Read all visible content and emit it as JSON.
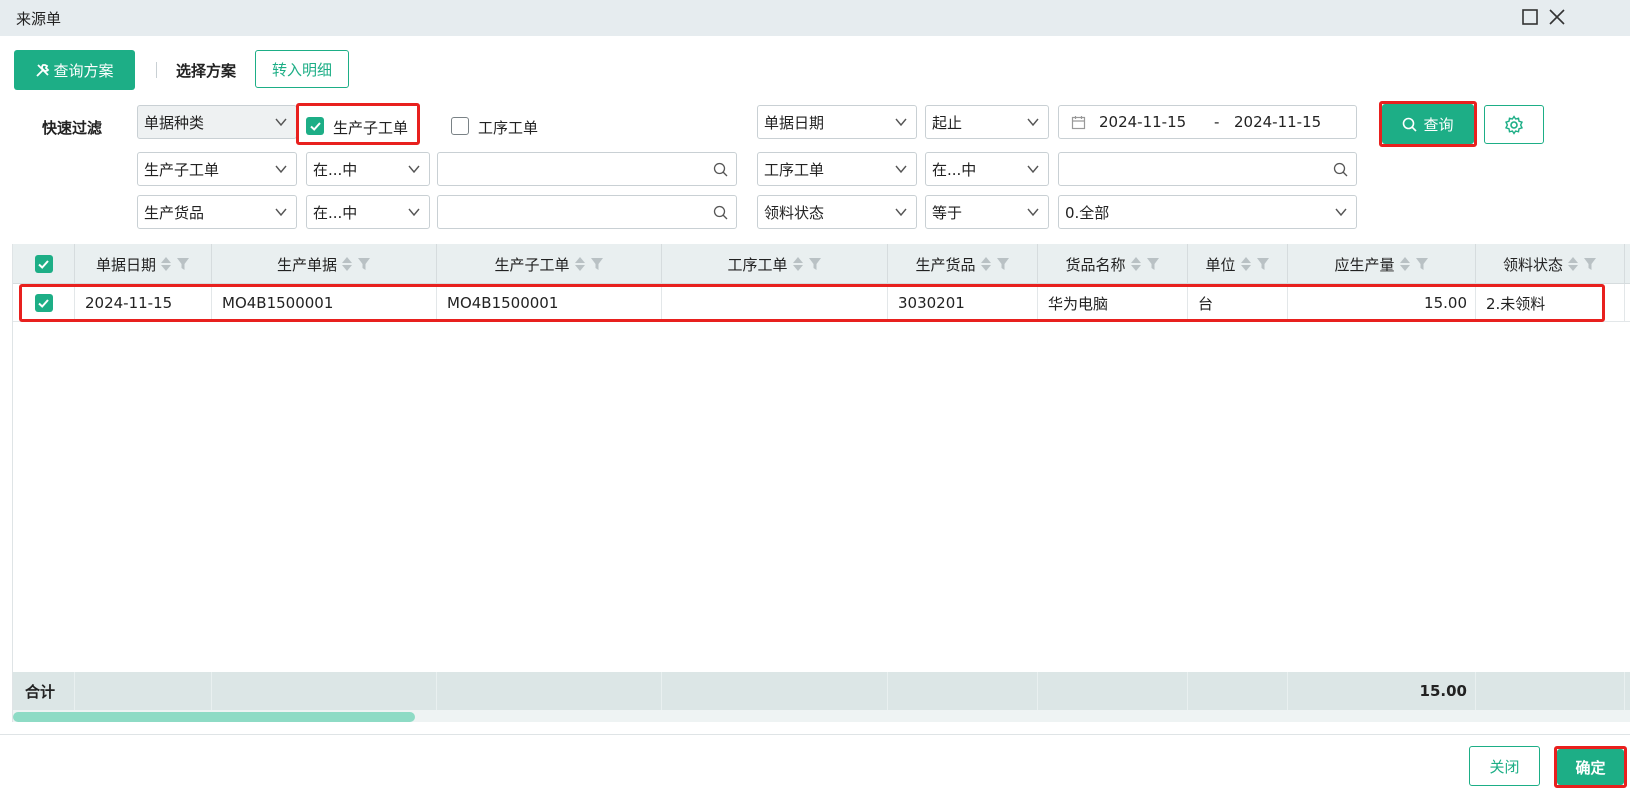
{
  "window": {
    "title": "来源单"
  },
  "toolbar": {
    "query_scheme_label": "查询方案",
    "select_scheme_label": "选择方案",
    "transfer_detail_label": "转入明细"
  },
  "filter": {
    "quick_filter_label": "快速过滤",
    "doc_type_select": "单据种类",
    "checkbox_production_sub": {
      "label": "生产子工单",
      "checked": true
    },
    "checkbox_process_order": {
      "label": "工序工单",
      "checked": false
    },
    "date_field_select": "单据日期",
    "date_mode_select": "起止",
    "date_start": "2024-11-15",
    "date_sep": "-",
    "date_end": "2024-11-15",
    "query_button_label": "查询",
    "row2": {
      "field1": "生产子工单",
      "op1": "在...中",
      "value1": "",
      "field2": "工序工单",
      "op2": "在...中",
      "value2": ""
    },
    "row3": {
      "field1": "生产货品",
      "op1": "在...中",
      "value1": "",
      "field2": "领料状态",
      "op2": "等于",
      "value2": "0.全部"
    }
  },
  "grid": {
    "columns": [
      "单据日期",
      "生产单据",
      "生产子工单",
      "工序工单",
      "生产货品",
      "货品名称",
      "单位",
      "应生产量",
      "领料状态"
    ],
    "rows": [
      {
        "checked": true,
        "cells": [
          "2024-11-15",
          "MO4B1500001",
          "MO4B1500001",
          "",
          "3030201",
          "华为电脑",
          "台",
          "15.00",
          "2.未领料"
        ]
      }
    ],
    "footer": {
      "label": "合计",
      "total_qty": "15.00"
    }
  },
  "footer": {
    "close_label": "关闭",
    "confirm_label": "确定"
  },
  "colors": {
    "accent": "#1dae86",
    "highlight": "#e8201e"
  }
}
